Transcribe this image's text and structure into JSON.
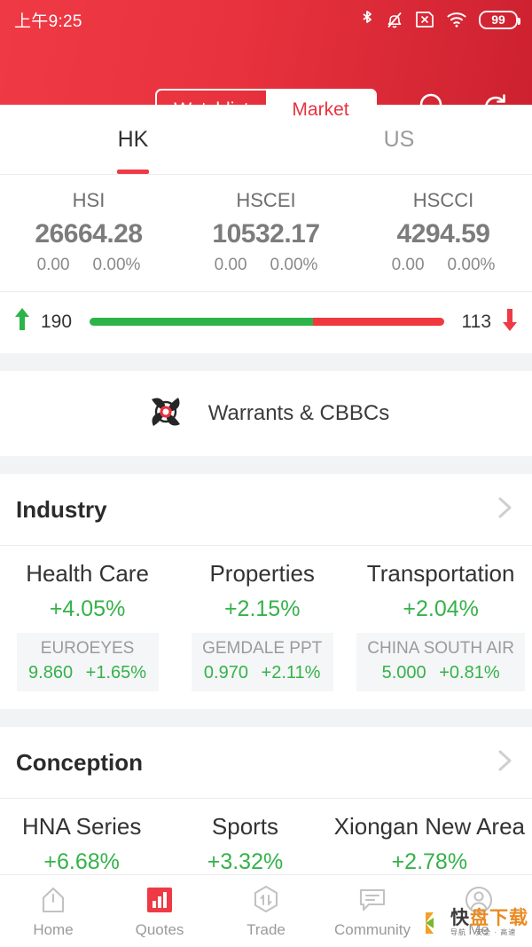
{
  "status_bar": {
    "time": "上午9:25",
    "battery_level": "99",
    "icons": [
      "bluetooth-icon",
      "bell-muted-icon",
      "sim-x-icon",
      "wifi-icon",
      "battery-icon"
    ]
  },
  "header": {
    "segmented": {
      "left_label": "Watchlist",
      "right_label": "Market",
      "selected": "Market"
    },
    "actions": [
      "search-icon",
      "refresh-icon"
    ],
    "accent_color": "#e8323e"
  },
  "market_tabs": [
    {
      "label": "HK",
      "active": true
    },
    {
      "label": "US",
      "active": false
    }
  ],
  "indices": [
    {
      "name": "HSI",
      "value": "26664.28",
      "change": "0.00",
      "change_pct": "0.00%"
    },
    {
      "name": "HSCEI",
      "value": "10532.17",
      "change": "0.00",
      "change_pct": "0.00%"
    },
    {
      "name": "HSCCI",
      "value": "4294.59",
      "change": "0.00",
      "change_pct": "0.00%"
    }
  ],
  "advance_decline": {
    "advancing": "190",
    "declining": "113",
    "advancing_ratio": 63,
    "up_color": "#2eb34a",
    "down_color": "#f0393f"
  },
  "warrants": {
    "label": "Warrants & CBBCs",
    "icon": "pinwheel-icon"
  },
  "sections": [
    {
      "title": "Industry",
      "cards": [
        {
          "name": "Health Care",
          "pct": "+4.05%",
          "stock": "EUROEYES",
          "price": "9.860",
          "stock_pct": "+1.65%"
        },
        {
          "name": "Properties",
          "pct": "+2.15%",
          "stock": "GEMDALE PPT",
          "price": "0.970",
          "stock_pct": "+2.11%"
        },
        {
          "name": "Transportation",
          "pct": "+2.04%",
          "stock": "CHINA SOUTH AIR",
          "price": "5.000",
          "stock_pct": "+0.81%"
        }
      ]
    },
    {
      "title": "Conception",
      "cards": [
        {
          "name": "HNA Series",
          "pct": "+6.68%",
          "stock": "",
          "price": "",
          "stock_pct": ""
        },
        {
          "name": "Sports",
          "pct": "+3.32%",
          "stock": "",
          "price": "",
          "stock_pct": ""
        },
        {
          "name": "Xiongan New Area",
          "pct": "+2.78%",
          "stock": "",
          "price": "",
          "stock_pct": ""
        }
      ]
    }
  ],
  "bottom_nav": [
    {
      "label": "Home",
      "icon": "home-icon",
      "active": false
    },
    {
      "label": "Quotes",
      "icon": "bar-chart-icon",
      "active": true
    },
    {
      "label": "Trade",
      "icon": "trade-icon",
      "active": false
    },
    {
      "label": "Community",
      "icon": "chat-icon",
      "active": false
    },
    {
      "label": "Me",
      "icon": "user-icon",
      "active": false
    }
  ],
  "watermark": {
    "main_dark": "快",
    "main_orange": "盘下载",
    "sub": "导航 · 安全 · 高速"
  },
  "colors": {
    "green": "#35b24a",
    "red": "#ef3a45",
    "section_bg": "#f2f3f5"
  }
}
